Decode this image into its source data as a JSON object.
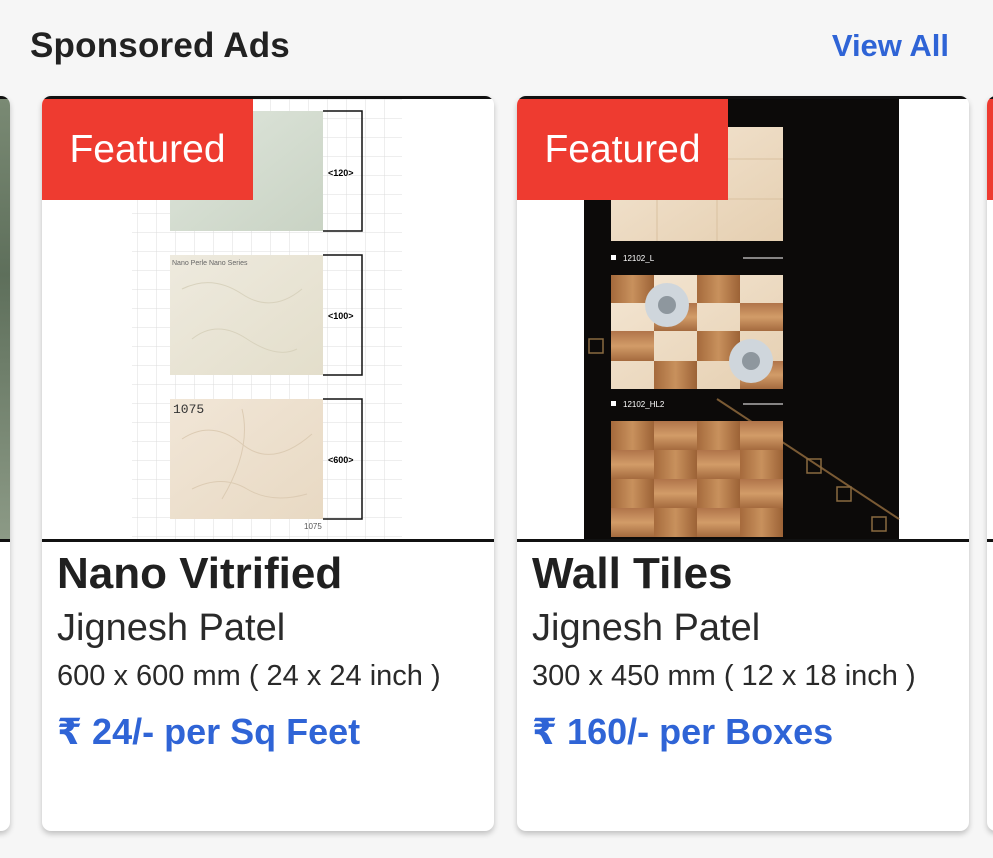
{
  "header": {
    "title": "Sponsored Ads",
    "view_all_label": "View All"
  },
  "colors": {
    "accent": "#2f64d6",
    "badge": "#ee3b30"
  },
  "cards": [
    {
      "badge": "Featured",
      "title": "Nano Vitrified",
      "seller": "Jignesh Patel",
      "size": "600 x 600 mm ( 24 x 24 inch )",
      "price": "₹ 24/- per Sq Feet",
      "image": {
        "tile_labels": [
          "<120>",
          "<100>",
          "<600>"
        ],
        "series_label": "Nano Perle Nano Series",
        "code_top": "1075",
        "code_bottom": "1075"
      }
    },
    {
      "badge": "Featured",
      "title": "Wall Tiles",
      "seller": "Jignesh Patel",
      "size": "300 x 450 mm ( 12 x 18 inch )",
      "price": "₹ 160/- per Boxes",
      "image": {
        "code_1": "12102_L",
        "code_2": "12102_HL2"
      }
    }
  ]
}
